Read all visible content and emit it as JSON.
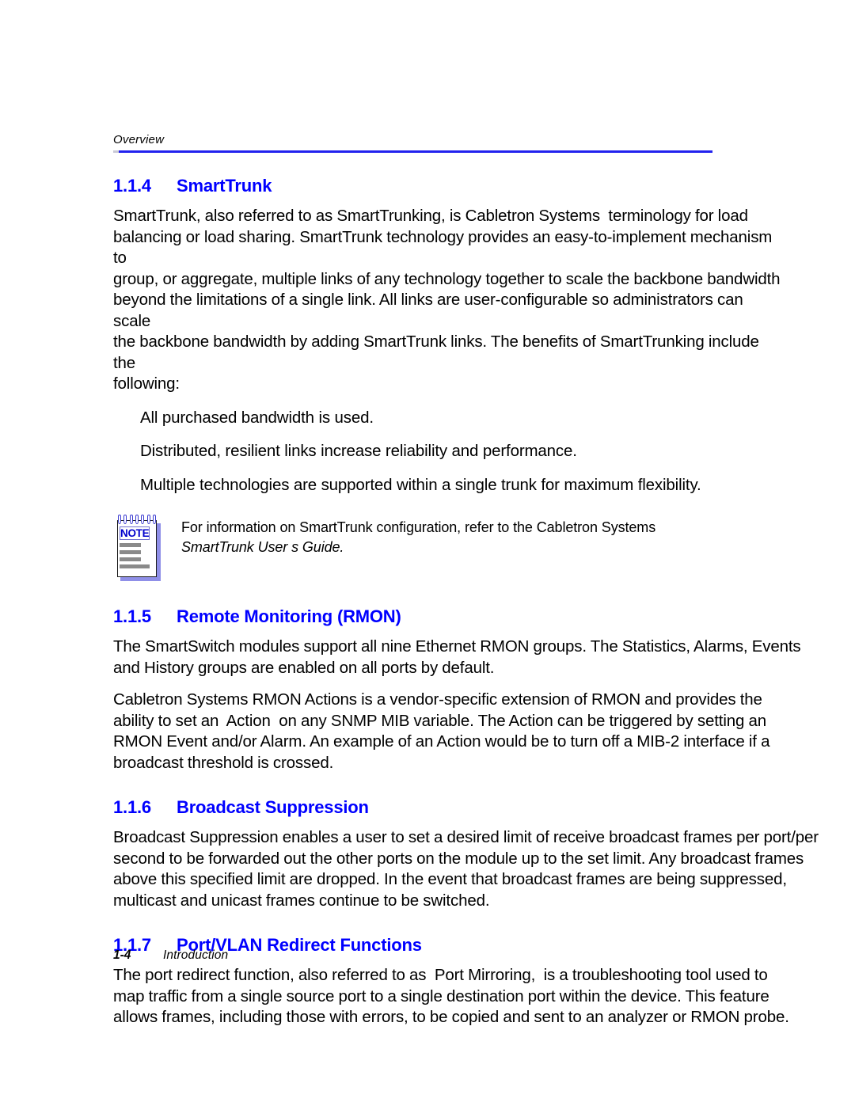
{
  "header": {
    "running_head": "Overview",
    "rule_color": "#2222ee"
  },
  "footer": {
    "page_number": "1-4",
    "chapter_title": "Introduction"
  },
  "theme": {
    "heading_color": "#0000ff",
    "body_color": "#000000",
    "note_label_color": "#0000cc",
    "note_shadow_color": "#8f8fe8",
    "note_line_color": "#8a8a8a"
  },
  "sections": [
    {
      "number": "1.1.4",
      "title": "SmartTrunk",
      "paragraph": "SmartTrunk, also referred to as SmartTrunking, is Cabletron Systems  terminology for load\nbalancing or load sharing. SmartTrunk technology provides an easy-to-implement mechanism to\ngroup, or aggregate, multiple links of any technology together to scale the backbone bandwidth\nbeyond the limitations of a single link. All links are user-configurable so administrators can scale\nthe backbone bandwidth by adding SmartTrunk links. The benefits of SmartTrunking include the\nfollowing:",
      "list": [
        "All purchased bandwidth is used.",
        "Distributed, resilient links increase reliability and performance.",
        "Multiple technologies are supported within a single trunk for maximum flexibility."
      ]
    },
    {
      "number": "1.1.5",
      "title": "Remote Monitoring (RMON)",
      "paragraph_1": "The SmartSwitch modules support all nine Ethernet RMON groups. The Statistics, Alarms, Events\nand History groups are enabled on all ports by default.",
      "paragraph_2": "Cabletron Systems RMON Actions is a vendor-specific extension of RMON and provides the\nability to set an  Action  on any SNMP MIB variable. The Action can be triggered by setting an\nRMON Event and/or Alarm. An example of an Action would be to turn off a MIB-2 interface if a\nbroadcast threshold is crossed."
    },
    {
      "number": "1.1.6",
      "title": "Broadcast Suppression",
      "paragraph": "Broadcast Suppression enables a user to set a desired limit of receive broadcast frames per port/per\nsecond to be forwarded out the other ports on the module up to the set limit. Any broadcast frames\nabove this specified limit are dropped. In the event that broadcast frames are being suppressed,\nmulticast and unicast frames continue to be switched."
    },
    {
      "number": "1.1.7",
      "title": "Port/VLAN Redirect Functions",
      "paragraph": "The port redirect function, also referred to as  Port Mirroring,  is a troubleshooting tool used to\nmap traffic from a single source port to a single destination port within the device. This feature\nallows frames, including those with errors, to be copied and sent to an analyzer or RMON probe."
    }
  ],
  "note": {
    "icon_label": "NOTE",
    "line_1": "For information on SmartTrunk configuration, refer to the Cabletron Systems",
    "line_2": "SmartTrunk User s Guide."
  }
}
